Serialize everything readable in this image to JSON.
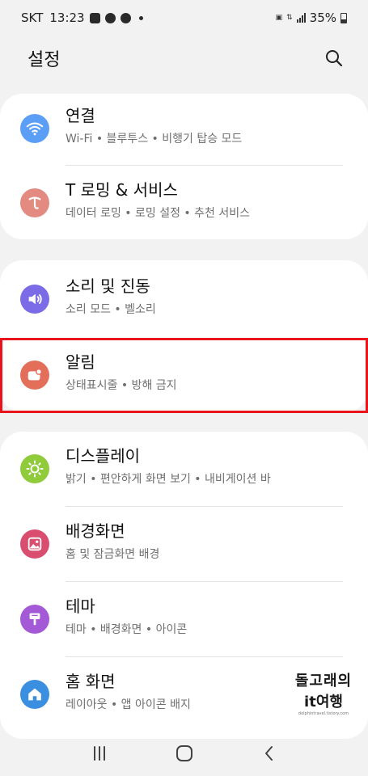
{
  "status": {
    "carrier": "SKT",
    "time": "13:23",
    "battery": "35%"
  },
  "header": {
    "title": "설정"
  },
  "groups": [
    {
      "items": [
        {
          "label": "연결",
          "sub": "Wi-Fi  •  블루투스  •  비행기 탑승 모드",
          "icon": "wifi-icon",
          "color": "#5a9ff5"
        },
        {
          "label": "T 로밍 & 서비스",
          "sub": "데이터 로밍  •  로밍 설정  •  추천 서비스",
          "icon": "tmap-icon",
          "color": "#e38b81"
        }
      ]
    },
    {
      "items": [
        {
          "label": "소리 및 진동",
          "sub": "소리 모드  •  벨소리",
          "icon": "speaker-icon",
          "color": "#7b6be6"
        },
        {
          "label": "알림",
          "sub": "상태표시줄  •  방해 금지",
          "icon": "notification-icon",
          "color": "#e36f5b"
        }
      ]
    },
    {
      "items": [
        {
          "label": "디스플레이",
          "sub": "밝기  •  편안하게 화면 보기  •  내비게이션 바",
          "icon": "sun-icon",
          "color": "#8fcb3a"
        },
        {
          "label": "배경화면",
          "sub": "홈 및 잠금화면 배경",
          "icon": "wallpaper-icon",
          "color": "#d94e6e"
        },
        {
          "label": "테마",
          "sub": "테마  •  배경화면  •  아이콘",
          "icon": "theme-icon",
          "color": "#a45ad6"
        },
        {
          "label": "홈 화면",
          "sub": "레이아웃  •  앱 아이콘 배지",
          "icon": "home-icon",
          "color": "#3b8fe0"
        }
      ]
    }
  ],
  "watermark": {
    "line1": "돌고래의",
    "line2": "it여행",
    "line3": "dolphintravel.tistory.com"
  }
}
